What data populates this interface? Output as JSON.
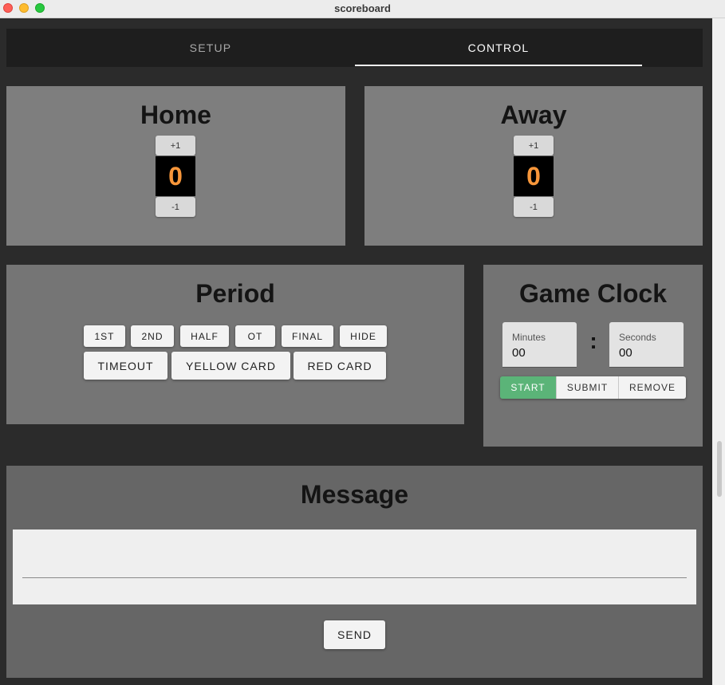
{
  "window": {
    "title": "scoreboard"
  },
  "tabs": [
    {
      "label": "SETUP",
      "active": false
    },
    {
      "label": "CONTROL",
      "active": true
    }
  ],
  "home": {
    "title": "Home",
    "score": "0",
    "plus_label": "+1",
    "minus_label": "-1"
  },
  "away": {
    "title": "Away",
    "score": "0",
    "plus_label": "+1",
    "minus_label": "-1"
  },
  "period": {
    "title": "Period",
    "buttons": [
      "1ST",
      "2ND",
      "HALF",
      "OT",
      "FINAL",
      "HIDE"
    ],
    "big_buttons": [
      "TIMEOUT",
      "YELLOW CARD",
      "RED CARD"
    ]
  },
  "clock": {
    "title": "Game Clock",
    "minutes_label": "Minutes",
    "minutes_value": "00",
    "separator": ":",
    "seconds_label": "Seconds",
    "seconds_value": "00",
    "start_label": "START",
    "submit_label": "SUBMIT",
    "remove_label": "REMOVE"
  },
  "message": {
    "title": "Message",
    "value": "",
    "send_label": "SEND"
  },
  "colors": {
    "score_digits": "#f7963a",
    "start_button": "#5bb478",
    "tab_bar": "#1e1e1e"
  }
}
